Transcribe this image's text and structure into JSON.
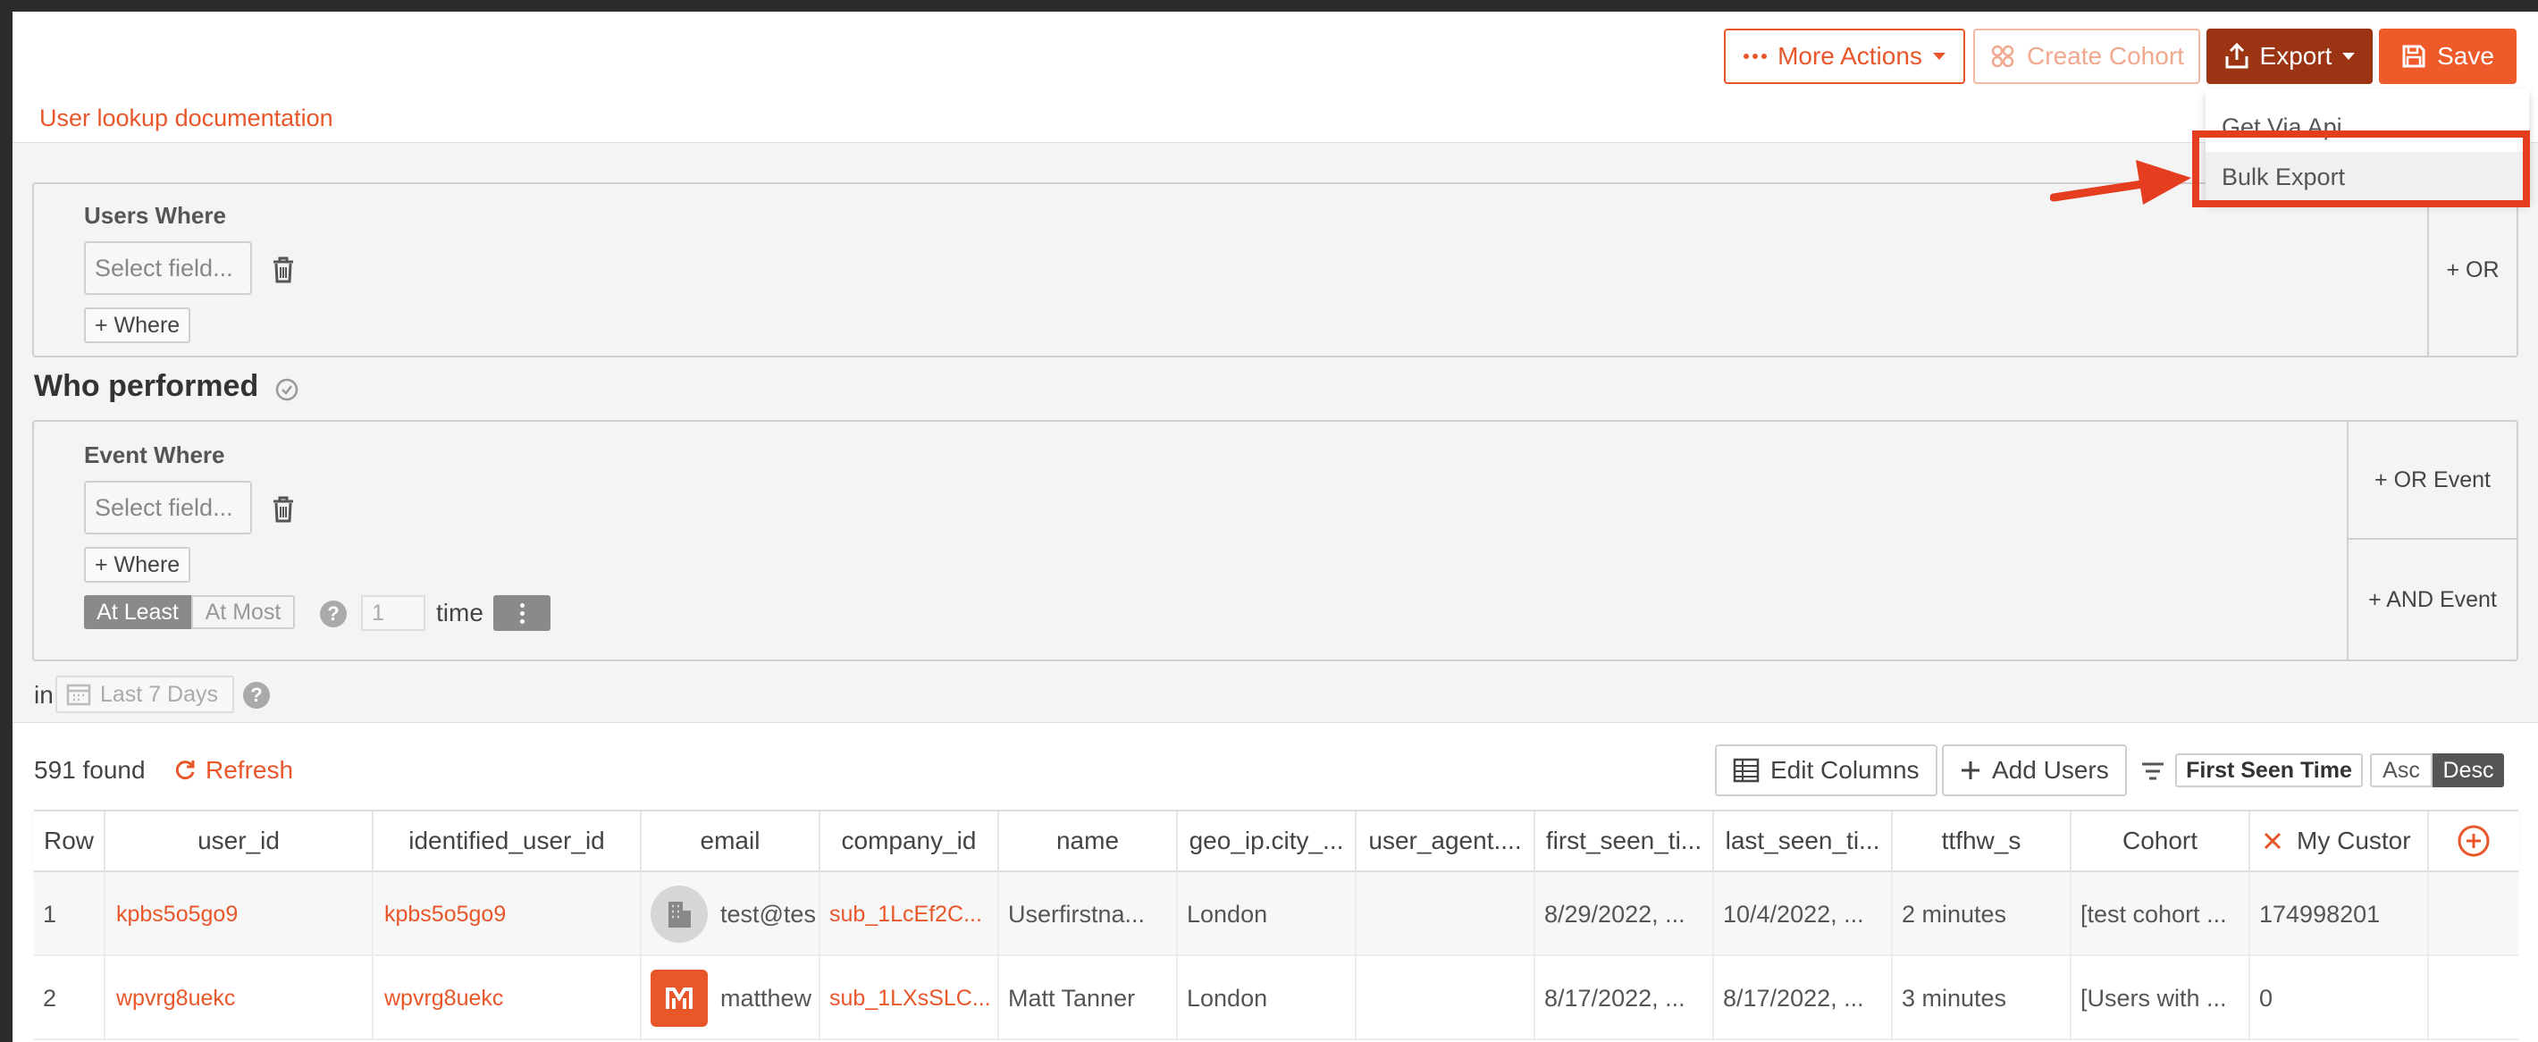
{
  "toolbar": {
    "more_actions": "More Actions",
    "create_cohort": "Create Cohort",
    "export": "Export",
    "save": "Save"
  },
  "doc_link": "User lookup documentation",
  "export_menu": {
    "items": [
      "Get Via Api",
      "Bulk Export"
    ]
  },
  "users_where": {
    "title": "Users Where",
    "select_placeholder": "Select field...",
    "add_where": "+ Where",
    "or": "+ OR"
  },
  "who_performed": {
    "title": "Who performed",
    "event_title": "Event Where",
    "select_placeholder": "Select field...",
    "add_where": "+ Where",
    "at_least": "At Least",
    "at_most": "At Most",
    "count": "1",
    "time": "time",
    "or_event": "+ OR Event",
    "and_event": "+ AND Event"
  },
  "date_range": {
    "in": "in",
    "label": "Last 7 Days"
  },
  "results": {
    "found": "591 found",
    "refresh": "Refresh",
    "edit_columns": "Edit Columns",
    "add_users": "Add Users",
    "sort_field": "First Seen Time",
    "asc": "Asc",
    "desc": "Desc"
  },
  "table": {
    "columns": [
      "Row",
      "user_id",
      "identified_user_id",
      "email",
      "company_id",
      "name",
      "geo_ip.city_...",
      "user_agent....",
      "first_seen_ti...",
      "last_seen_ti...",
      "ttfhw_s",
      "Cohort",
      "My Custor"
    ],
    "rows": [
      [
        "1",
        "kpbs5o5go9",
        "kpbs5o5go9",
        "test@tes",
        "sub_1LcEf2C...",
        "Userfirstna...",
        "London",
        "",
        "8/29/2022, ...",
        "10/4/2022, ...",
        "2 minutes",
        "[test cohort ...",
        "174998201"
      ],
      [
        "2",
        "wpvrg8uekc",
        "wpvrg8uekc",
        "matthew",
        "sub_1LXsSLC...",
        "Matt Tanner",
        "London",
        "",
        "8/17/2022, ...",
        "8/17/2022, ...",
        "3 minutes",
        "[Users with ...",
        "0"
      ]
    ]
  },
  "colors": {
    "accent": "#e8562a",
    "export_button": "#9a3412",
    "save_button": "#ef5a2a",
    "highlight": "#e53d1f"
  }
}
